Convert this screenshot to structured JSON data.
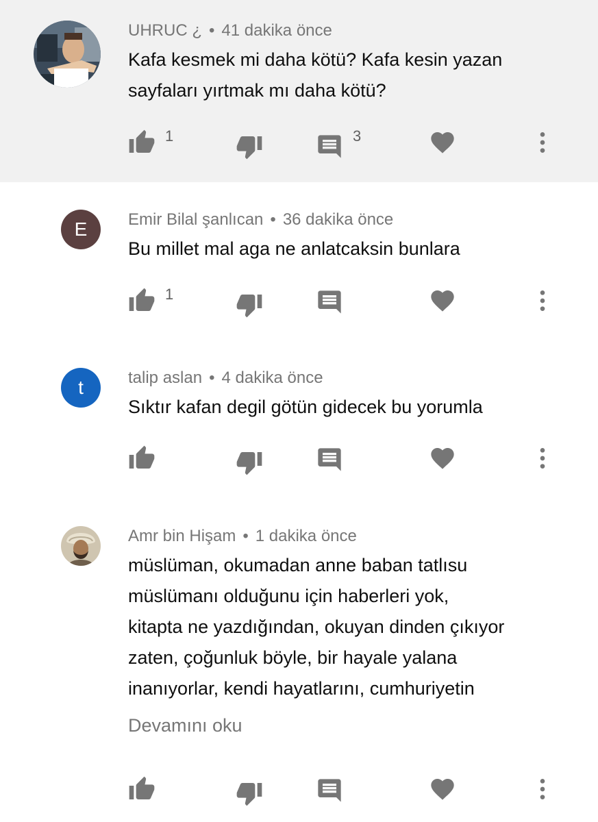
{
  "colors": {
    "highlight_bg": "#f1f1f1",
    "icon": "#767676",
    "meta_text": "#767676",
    "body_text": "#0f0f0f",
    "avatar_e": "#5b4040",
    "avatar_t": "#1565c0"
  },
  "separator": "•",
  "actions_icons": [
    "thumbs-up-icon",
    "thumbs-down-icon",
    "reply-icon",
    "heart-icon",
    "more-vert-icon"
  ],
  "comments": [
    {
      "author": "UHRUC ¿",
      "time": "41 dakika önce",
      "text_lines": [
        "Kafa kesmek mi daha kötü? Kafa kesin yazan",
        "sayfaları yırtmak mı daha kötü?"
      ],
      "likes": "1",
      "replies": "3",
      "avatar": "photo"
    },
    {
      "author": "Emir Bilal şanlıcan",
      "time": "36 dakika önce",
      "text_lines": [
        "Bu millet mal aga ne anlatcaksin bunlara"
      ],
      "likes": "1",
      "replies": "",
      "avatar_letter": "E"
    },
    {
      "author": "talip aslan",
      "time": "4 dakika önce",
      "text_lines": [
        "Sıktır kafan degil götün gidecek bu yorumla"
      ],
      "likes": "",
      "replies": "",
      "avatar_letter": "t"
    },
    {
      "author": "Amr bin Hişam",
      "time": "1 dakika önce",
      "text_lines": [
        "müslüman, okumadan anne baban tatlısu",
        "müslümanı olduğunu için haberleri yok,",
        "kitapta ne yazdığından, okuyan dinden çıkıyor",
        "zaten, çoğunluk böyle, bir hayale yalana",
        "inanıyorlar, kendi hayatlarını, cumhuriyetin"
      ],
      "read_more": "Devamını oku",
      "likes": "",
      "replies": "",
      "avatar": "photo"
    }
  ]
}
